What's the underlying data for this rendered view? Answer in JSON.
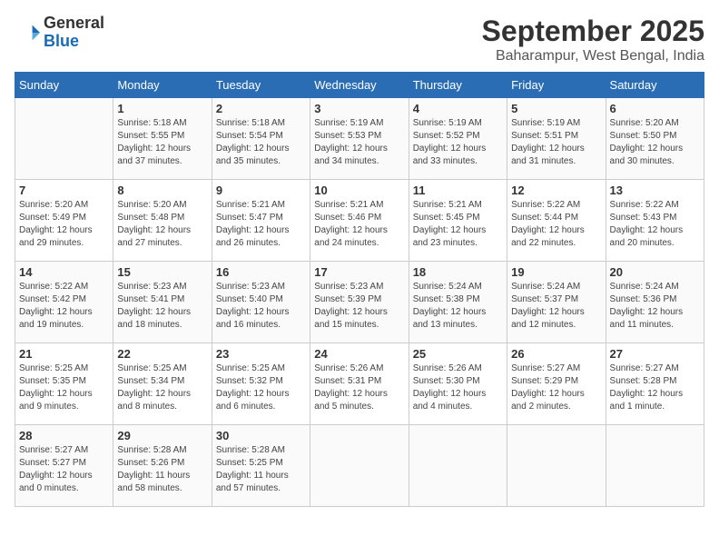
{
  "header": {
    "logo": {
      "line1": "General",
      "line2": "Blue"
    },
    "title": "September 2025",
    "subtitle": "Baharampur, West Bengal, India"
  },
  "days_of_week": [
    "Sunday",
    "Monday",
    "Tuesday",
    "Wednesday",
    "Thursday",
    "Friday",
    "Saturday"
  ],
  "weeks": [
    [
      {
        "day": "",
        "info": ""
      },
      {
        "day": "1",
        "info": "Sunrise: 5:18 AM\nSunset: 5:55 PM\nDaylight: 12 hours\nand 37 minutes."
      },
      {
        "day": "2",
        "info": "Sunrise: 5:18 AM\nSunset: 5:54 PM\nDaylight: 12 hours\nand 35 minutes."
      },
      {
        "day": "3",
        "info": "Sunrise: 5:19 AM\nSunset: 5:53 PM\nDaylight: 12 hours\nand 34 minutes."
      },
      {
        "day": "4",
        "info": "Sunrise: 5:19 AM\nSunset: 5:52 PM\nDaylight: 12 hours\nand 33 minutes."
      },
      {
        "day": "5",
        "info": "Sunrise: 5:19 AM\nSunset: 5:51 PM\nDaylight: 12 hours\nand 31 minutes."
      },
      {
        "day": "6",
        "info": "Sunrise: 5:20 AM\nSunset: 5:50 PM\nDaylight: 12 hours\nand 30 minutes."
      }
    ],
    [
      {
        "day": "7",
        "info": "Sunrise: 5:20 AM\nSunset: 5:49 PM\nDaylight: 12 hours\nand 29 minutes."
      },
      {
        "day": "8",
        "info": "Sunrise: 5:20 AM\nSunset: 5:48 PM\nDaylight: 12 hours\nand 27 minutes."
      },
      {
        "day": "9",
        "info": "Sunrise: 5:21 AM\nSunset: 5:47 PM\nDaylight: 12 hours\nand 26 minutes."
      },
      {
        "day": "10",
        "info": "Sunrise: 5:21 AM\nSunset: 5:46 PM\nDaylight: 12 hours\nand 24 minutes."
      },
      {
        "day": "11",
        "info": "Sunrise: 5:21 AM\nSunset: 5:45 PM\nDaylight: 12 hours\nand 23 minutes."
      },
      {
        "day": "12",
        "info": "Sunrise: 5:22 AM\nSunset: 5:44 PM\nDaylight: 12 hours\nand 22 minutes."
      },
      {
        "day": "13",
        "info": "Sunrise: 5:22 AM\nSunset: 5:43 PM\nDaylight: 12 hours\nand 20 minutes."
      }
    ],
    [
      {
        "day": "14",
        "info": "Sunrise: 5:22 AM\nSunset: 5:42 PM\nDaylight: 12 hours\nand 19 minutes."
      },
      {
        "day": "15",
        "info": "Sunrise: 5:23 AM\nSunset: 5:41 PM\nDaylight: 12 hours\nand 18 minutes."
      },
      {
        "day": "16",
        "info": "Sunrise: 5:23 AM\nSunset: 5:40 PM\nDaylight: 12 hours\nand 16 minutes."
      },
      {
        "day": "17",
        "info": "Sunrise: 5:23 AM\nSunset: 5:39 PM\nDaylight: 12 hours\nand 15 minutes."
      },
      {
        "day": "18",
        "info": "Sunrise: 5:24 AM\nSunset: 5:38 PM\nDaylight: 12 hours\nand 13 minutes."
      },
      {
        "day": "19",
        "info": "Sunrise: 5:24 AM\nSunset: 5:37 PM\nDaylight: 12 hours\nand 12 minutes."
      },
      {
        "day": "20",
        "info": "Sunrise: 5:24 AM\nSunset: 5:36 PM\nDaylight: 12 hours\nand 11 minutes."
      }
    ],
    [
      {
        "day": "21",
        "info": "Sunrise: 5:25 AM\nSunset: 5:35 PM\nDaylight: 12 hours\nand 9 minutes."
      },
      {
        "day": "22",
        "info": "Sunrise: 5:25 AM\nSunset: 5:34 PM\nDaylight: 12 hours\nand 8 minutes."
      },
      {
        "day": "23",
        "info": "Sunrise: 5:25 AM\nSunset: 5:32 PM\nDaylight: 12 hours\nand 6 minutes."
      },
      {
        "day": "24",
        "info": "Sunrise: 5:26 AM\nSunset: 5:31 PM\nDaylight: 12 hours\nand 5 minutes."
      },
      {
        "day": "25",
        "info": "Sunrise: 5:26 AM\nSunset: 5:30 PM\nDaylight: 12 hours\nand 4 minutes."
      },
      {
        "day": "26",
        "info": "Sunrise: 5:27 AM\nSunset: 5:29 PM\nDaylight: 12 hours\nand 2 minutes."
      },
      {
        "day": "27",
        "info": "Sunrise: 5:27 AM\nSunset: 5:28 PM\nDaylight: 12 hours\nand 1 minute."
      }
    ],
    [
      {
        "day": "28",
        "info": "Sunrise: 5:27 AM\nSunset: 5:27 PM\nDaylight: 12 hours\nand 0 minutes."
      },
      {
        "day": "29",
        "info": "Sunrise: 5:28 AM\nSunset: 5:26 PM\nDaylight: 11 hours\nand 58 minutes."
      },
      {
        "day": "30",
        "info": "Sunrise: 5:28 AM\nSunset: 5:25 PM\nDaylight: 11 hours\nand 57 minutes."
      },
      {
        "day": "",
        "info": ""
      },
      {
        "day": "",
        "info": ""
      },
      {
        "day": "",
        "info": ""
      },
      {
        "day": "",
        "info": ""
      }
    ]
  ]
}
